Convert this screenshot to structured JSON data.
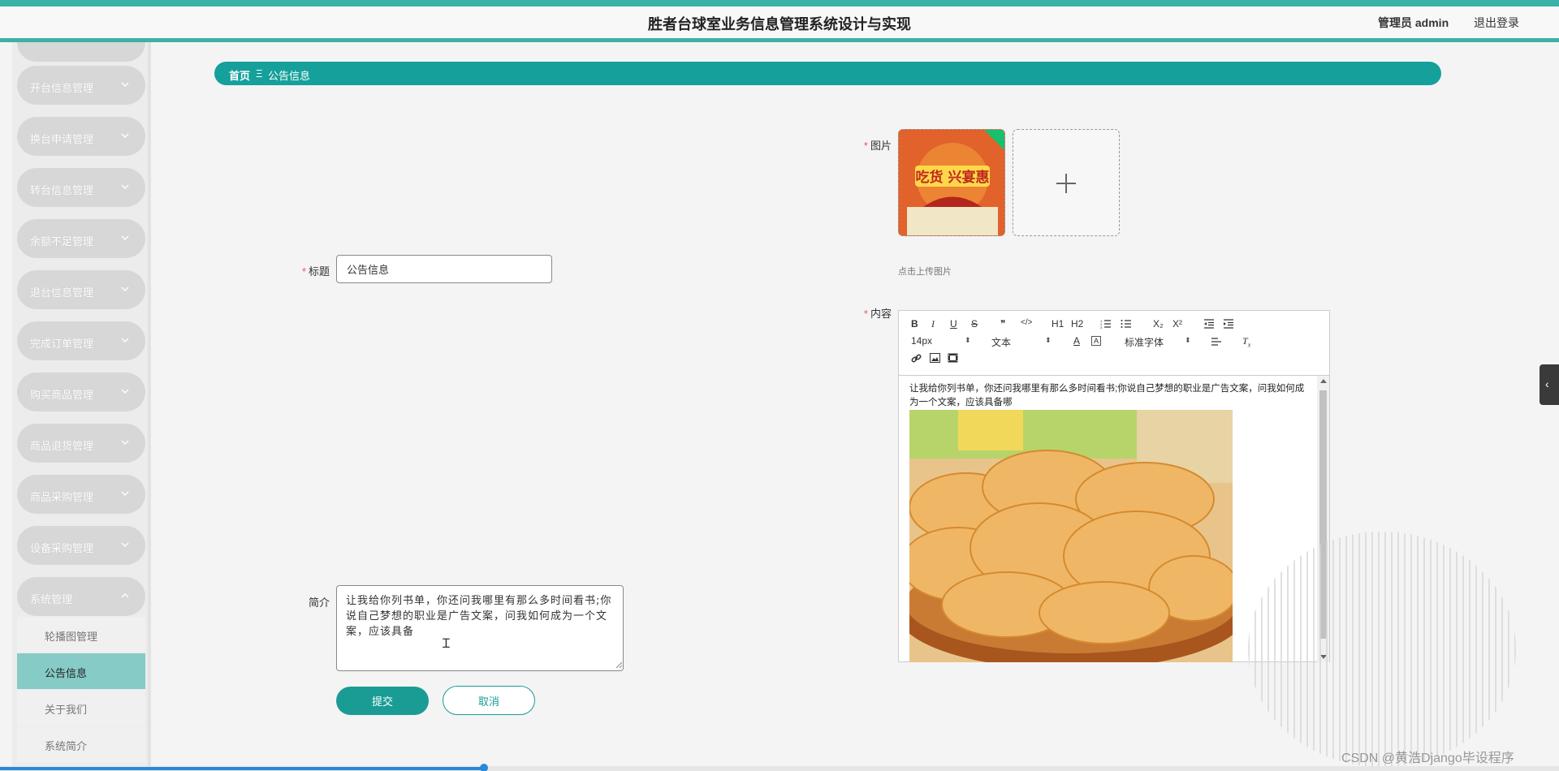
{
  "header": {
    "title": "胜者台球室业务信息管理系统设计与实现",
    "admin_label": "管理员 admin",
    "logout_label": "退出登录"
  },
  "sidebar": {
    "menus": [
      {
        "label": "开台信息管理",
        "expanded": false
      },
      {
        "label": "换台申请管理",
        "expanded": false
      },
      {
        "label": "转台信息管理",
        "expanded": false
      },
      {
        "label": "余额不足管理",
        "expanded": false
      },
      {
        "label": "退台信息管理",
        "expanded": false
      },
      {
        "label": "完成订单管理",
        "expanded": false
      },
      {
        "label": "购买商品管理",
        "expanded": false
      },
      {
        "label": "商品退货管理",
        "expanded": false
      },
      {
        "label": "商品采购管理",
        "expanded": false
      },
      {
        "label": "设备采购管理",
        "expanded": false
      },
      {
        "label": "系统管理",
        "expanded": true
      }
    ],
    "submenu": [
      {
        "label": "轮播图管理",
        "active": false
      },
      {
        "label": "公告信息",
        "active": true
      },
      {
        "label": "关于我们",
        "active": false
      },
      {
        "label": "系统简介",
        "active": false
      }
    ]
  },
  "breadcrumb": {
    "home": "首页",
    "separator": "Ξ",
    "current": "公告信息"
  },
  "form": {
    "title_label": "标题",
    "title_value": "公告信息",
    "image_label": "图片",
    "upload_hint": "点击上传图片",
    "thumbnail_text": "吃货 兴宴惠",
    "content_label": "内容",
    "content_text": "让我给你列书单，你还问我哪里有那么多时间看书;你说自己梦想的职业是广告文案，问我如何成为一个文案，应该具备哪",
    "intro_label": "简介",
    "intro_value": "让我给你列书单，你还问我哪里有那么多时间看书;你说自己梦想的职业是广告文案，问我如何成为一个文案，应该具备",
    "submit_label": "提交",
    "cancel_label": "取消"
  },
  "editor": {
    "toolbar_row1": [
      "B",
      "I",
      "U",
      "S",
      "❞",
      "</>",
      "H1",
      "H2",
      "ordered-list",
      "bullet-list",
      "X₂",
      "X²",
      "outdent",
      "indent"
    ],
    "font_size": "14px",
    "paragraph": "文本",
    "font_family": "标准字体",
    "toolbar_row3": [
      "link-icon",
      "image-icon",
      "video-icon"
    ]
  },
  "icons": {
    "chevron": "chevron-down-icon",
    "plus": "plus-icon"
  },
  "colors": {
    "accent": "#15a09b",
    "header_strip": "#3db0a7",
    "menu_pill": "#d7d7d7",
    "active_sub": "#86cbc6",
    "required": "#e25b5b"
  },
  "watermark": "CSDN @黄浩Django毕设程序"
}
